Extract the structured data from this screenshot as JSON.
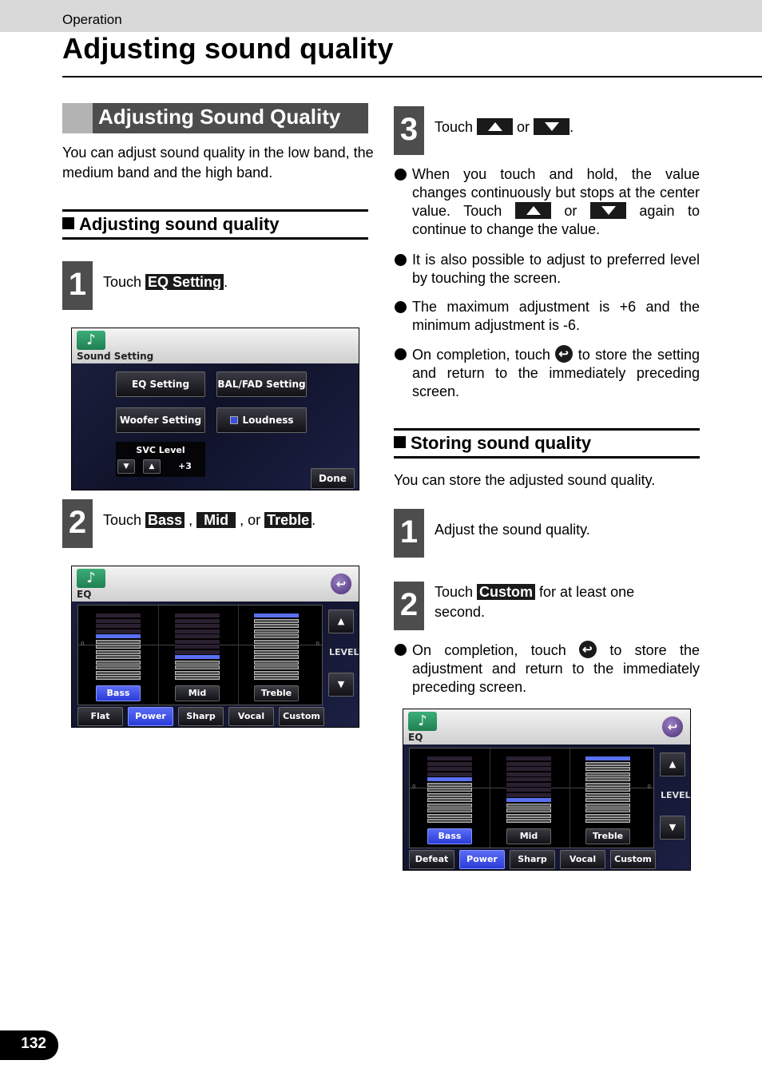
{
  "header": {
    "section": "Operation",
    "title": "Adjusting sound quality"
  },
  "left": {
    "banner": "Adjusting Sound Quality",
    "intro": "You can adjust sound quality in the low band, the medium band and the high band.",
    "subhead": "Adjusting sound quality",
    "step1": {
      "number": "1",
      "prefix": "Touch ",
      "key": "EQ Setting",
      "suffix": "."
    },
    "step2": {
      "number": "2",
      "prefix": "Touch ",
      "keys": [
        "Bass",
        "Mid",
        "Treble"
      ],
      "sep1": " , ",
      "sep2": " , or ",
      "suffix": "."
    }
  },
  "screen_sound": {
    "title": "Sound Setting",
    "buttons": [
      "EQ Setting",
      "BAL/FAD Setting",
      "Woofer Setting",
      "Loudness"
    ],
    "svc_label": "SVC Level",
    "svc_value": "+3",
    "done": "Done",
    "loudness_color": "#3a4fe0"
  },
  "screen_eq1": {
    "title": "EQ",
    "bands": [
      {
        "label": "Bass",
        "level": 2,
        "active": true
      },
      {
        "label": "Mid",
        "level": -2,
        "active": false
      },
      {
        "label": "Treble",
        "level": 6,
        "active": false
      }
    ],
    "level_label": "LEVEL",
    "zero_label": "0",
    "presets": [
      "Flat",
      "Power",
      "Sharp",
      "Vocal",
      "Custom"
    ],
    "active_preset": "Power"
  },
  "right": {
    "step3": {
      "number": "3",
      "prefix": "Touch ",
      "or": " or ",
      "suffix": "."
    },
    "bullet1": {
      "a": "When you touch and hold, the value changes continuously but stops at the center value. Touch ",
      "or": " or ",
      "b": " again to continue to change the value."
    },
    "bullet2": "It is also possible to adjust to preferred level by touching the screen.",
    "bullet3": "The maximum adjustment is +6 and the minimum adjustment is -6.",
    "bullet4": {
      "a": "On completion, touch ",
      "b": " to store the setting and return to the immediately preceding screen."
    },
    "subhead": "Storing sound quality",
    "intro": "You can store the adjusted sound quality.",
    "s_step1": {
      "number": "1",
      "text": "Adjust the sound quality."
    },
    "s_step2": {
      "number": "2",
      "prefix": "Touch ",
      "key": "Custom",
      "suffix": " for at least one second."
    },
    "bullet5": {
      "a": "On completion, touch ",
      "b": " to store the adjustment and return to the immediately preceding screen."
    }
  },
  "screen_eq2": {
    "title": "EQ",
    "bands": [
      {
        "label": "Bass",
        "level": 2,
        "active": true
      },
      {
        "label": "Mid",
        "level": -2,
        "active": false
      },
      {
        "label": "Treble",
        "level": 6,
        "active": false
      }
    ],
    "level_label": "LEVEL",
    "zero_label": "0",
    "presets": [
      "Defeat",
      "Power",
      "Sharp",
      "Vocal",
      "Custom"
    ],
    "active_preset": "Power"
  },
  "footer": {
    "page": "132"
  }
}
